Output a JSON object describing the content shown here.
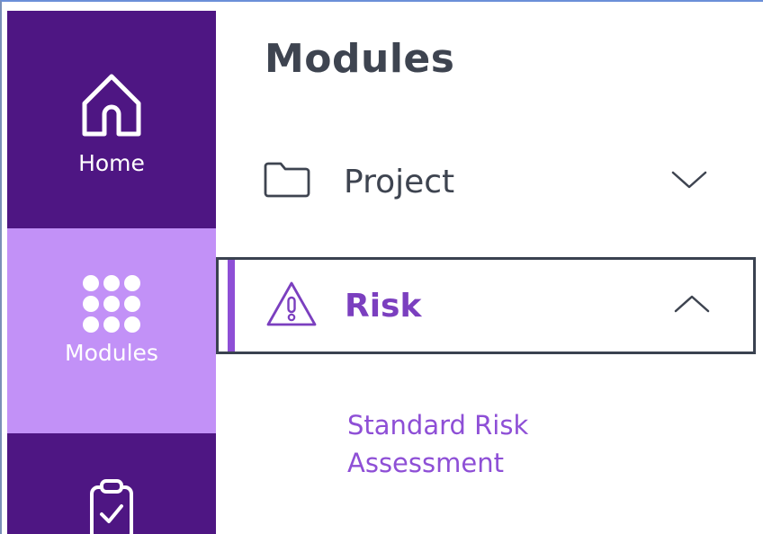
{
  "rail": {
    "items": [
      {
        "label": "Home",
        "icon": "home-icon"
      },
      {
        "label": "Modules",
        "icon": "grid-dots-icon"
      },
      {
        "label": "",
        "icon": "clipboard-check-icon"
      }
    ]
  },
  "panel": {
    "title": "Modules",
    "menu": [
      {
        "label": "Project",
        "icon": "folder-icon",
        "chevron": "chevron-down-icon",
        "expanded": false
      },
      {
        "label": "Risk",
        "icon": "warning-icon",
        "chevron": "chevron-up-icon",
        "expanded": true
      }
    ],
    "submenu": [
      {
        "label": "Standard Risk Assessment"
      }
    ]
  },
  "colors": {
    "rail_dark": "#4e1683",
    "rail_active": "#c291f7",
    "accent": "#8e4fd6",
    "text_dark": "#3e4450"
  }
}
